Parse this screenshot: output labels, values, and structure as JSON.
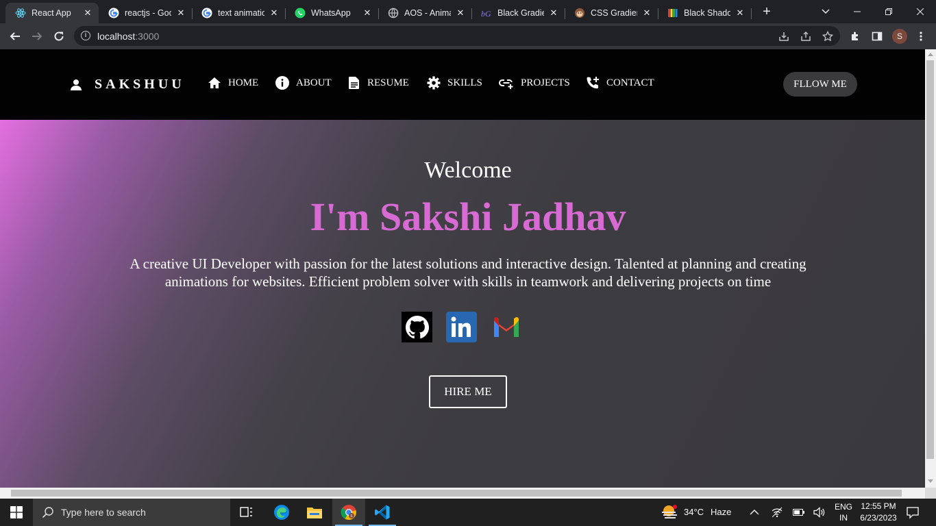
{
  "browser": {
    "tabs": [
      {
        "title": "React App",
        "active": true
      },
      {
        "title": "reactjs - Goo",
        "active": false
      },
      {
        "title": "text animatio",
        "active": false
      },
      {
        "title": "WhatsApp",
        "active": false
      },
      {
        "title": "AOS - Animat",
        "active": false
      },
      {
        "title": "Black Gradien",
        "active": false
      },
      {
        "title": "CSS Gradient",
        "active": false
      },
      {
        "title": "Black Shadow",
        "active": false
      }
    ],
    "url_host": "localhost",
    "url_port": ":3000",
    "profile_initial": "S"
  },
  "site": {
    "brand": "SAKSHUU",
    "nav": [
      "HOME",
      "ABOUT",
      "RESUME",
      "SKILLS",
      "PROJECTS",
      "CONTACT"
    ],
    "follow_button": "FLLOW ME",
    "hero": {
      "welcome": "Welcome",
      "name": "I'm Sakshi Jadhav",
      "description": "A creative UI Developer with passion for the latest solutions and interactive design. Talented at planning and creating animations for websites. Efficient problem solver with skills in teamwork and delivering projects on time",
      "socials": [
        "github-icon",
        "linkedin-icon",
        "gmail-icon"
      ],
      "hire_button": "HIRE ME"
    },
    "colors": {
      "accent": "#d86ad4",
      "navbar": "#020202",
      "hero_bg": "#3a393d"
    }
  },
  "taskbar": {
    "search_placeholder": "Type here to search",
    "weather_temp": "34°C",
    "weather_desc": "Haze",
    "lang_line1": "ENG",
    "lang_line2": "IN",
    "time": "12:55 PM",
    "date": "6/23/2023"
  }
}
